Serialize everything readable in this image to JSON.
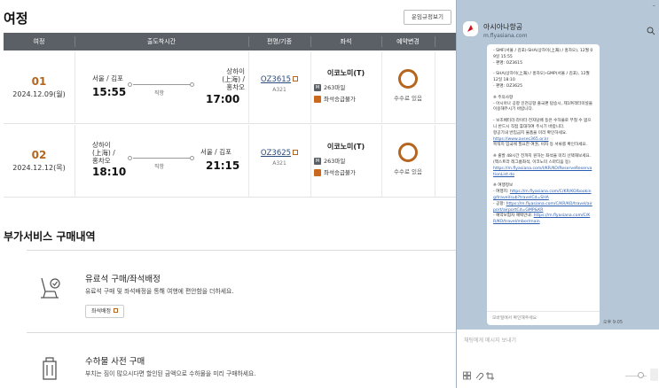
{
  "page": {
    "title": "여정",
    "rules_button": "운임규정보기"
  },
  "table": {
    "headers": [
      "여정",
      "출도착시간",
      "편명/기종",
      "좌석",
      "예약변경"
    ],
    "direct_label": "직항",
    "rows": [
      {
        "seq": "01",
        "date": "2024.12.09(월)",
        "dep_city": "서울 / 김포",
        "dep_time": "15:55",
        "arr_city_l1": "상하이",
        "arr_city_l2": "(上海) /",
        "arr_city_l3": "홍차오",
        "arr_time": "17:00",
        "flight": "OZ3615",
        "aircraft": "A321",
        "cabin": "이코노미(T)",
        "miles": "263마일",
        "seat_assign": "좌석승급불가",
        "fee": "수수료 있음"
      },
      {
        "seq": "02",
        "date": "2024.12.12(목)",
        "dep_city_l1": "상하이",
        "dep_city_l2": "(上海) /",
        "dep_city_l3": "홍차오",
        "dep_time": "18:10",
        "arr_city": "서울 / 김포",
        "arr_time": "21:15",
        "flight": "OZ3625",
        "aircraft": "A321",
        "cabin": "이코노미(T)",
        "miles": "263마일",
        "seat_assign": "좌석승급불가",
        "fee": "수수료 있음"
      }
    ]
  },
  "extras": {
    "title": "부가서비스 구매내역",
    "items": [
      {
        "title": "유료석 구매/좌석배정",
        "desc": "유료석 구매 및 좌석배정을 통해 여행에 편안함을 더하세요.",
        "button": "좌석배정"
      },
      {
        "title": "수하물 사전 구매",
        "desc": "부치는 짐이 많으시다면 할인된 금액으로 수하물을 미리 구매하세요."
      }
    ]
  },
  "chat": {
    "window_controls": "–",
    "channel_name": "아시아나항공",
    "channel_url": "m.flyasiana.com",
    "message": {
      "seg1": "- SMF(서울 / 김포)-SHA(상하이(上海) / 홍차오), 12월 09일 15:55\n- 편명: OZ3615",
      "seg2": "- SHA(상하이(上海) / 홍차오)-GMP(서울 / 김포), 12월 12일 18:10\n- 편명: OZ3625",
      "notice_title": "※ 주의사항",
      "notice1": "- 아시아나 공항 인천공항 출국편 탑승시, 제1여객터미널을 이용해주시기 바랍니다.",
      "notice2": "- 보조배터리·라이터·전자담배 등은 수하물로 부칠 수 없으니 반드시 직접 휴대하여 주시기 바랍니다.\n항공기내 반입금지 물품을 미리 확인하세요.",
      "link_cases": "https://www.avsec365.or.kr",
      "notice3": "목적지 입국에 필요한 여권, 비자 등 서류를 확인하세요.",
      "checkin_text": "※ 출발 48시간 전까지 원하는 좌석을 미리 선택해보세요. (엑스트라 레그룸좌석, 이코노미 스마티움 등)",
      "checkin_link": "https://m.flyasiana.com/I/KR/KO/ReserveReservationList.do",
      "info_title": "※ 여행정보",
      "info_trip_label": "- 여행지:",
      "info_trip_link": "https://m.flyasiana.com/C/KR/KO/booking/travel/sub?travelCd=SHA",
      "info_airport_label": "- 공항:",
      "info_airport_link": "https://m.flyasiana.com/C/KR/KO/travel/airport/airportCd=GMP&KR",
      "info_wifi_label": "- 예약보험자 혜택안내:",
      "info_wifi_link": "https://m.flyasiana.com/C/KR/KO/travel/mbor/main",
      "footer": "모바일에서 확인해주세요"
    },
    "time": "오후 9:05",
    "input_placeholder": "채팅에게 메시지 보내기"
  }
}
